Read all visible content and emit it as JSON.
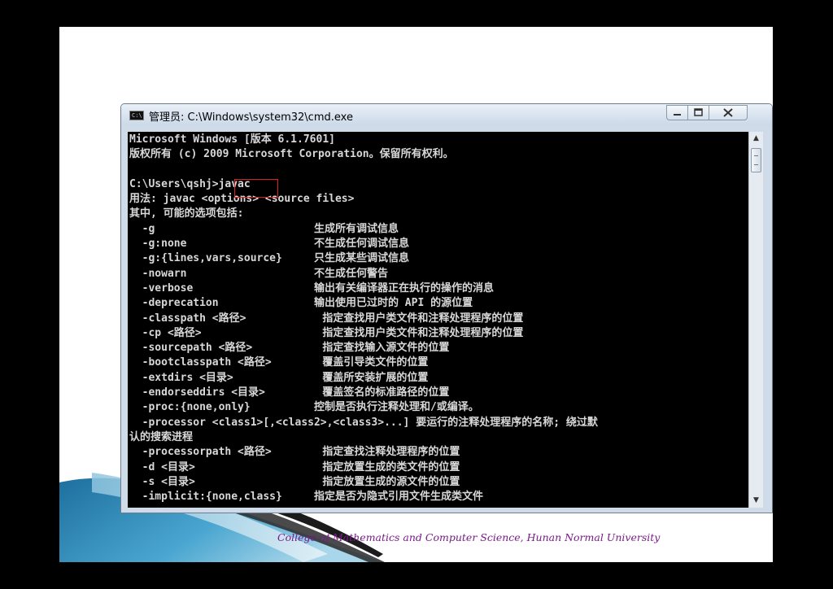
{
  "window": {
    "title": "管理员: C:\\Windows\\system32\\cmd.exe",
    "icon": "cmd-icon",
    "controls": {
      "minimize": "minimize-icon",
      "maximize": "maximize-icon",
      "close": "close-icon"
    }
  },
  "console": {
    "lines": [
      "Microsoft Windows [版本 6.1.7601]",
      "版权所有 (c) 2009 Microsoft Corporation。保留所有权利。",
      "",
      "C:\\Users\\qshj>javac",
      "用法: javac <options> <source files>",
      "其中, 可能的选项包括:",
      "  -g                         生成所有调试信息",
      "  -g:none                    不生成任何调试信息",
      "  -g:{lines,vars,source}     只生成某些调试信息",
      "  -nowarn                    不生成任何警告",
      "  -verbose                   输出有关编译器正在执行的操作的消息",
      "  -deprecation               输出使用已过时的 API 的源位置",
      "  -classpath <路径>            指定查找用户类文件和注释处理程序的位置",
      "  -cp <路径>                   指定查找用户类文件和注释处理程序的位置",
      "  -sourcepath <路径>           指定查找输入源文件的位置",
      "  -bootclasspath <路径>        覆盖引导类文件的位置",
      "  -extdirs <目录>              覆盖所安装扩展的位置",
      "  -endorseddirs <目录>         覆盖签名的标准路径的位置",
      "  -proc:{none,only}          控制是否执行注释处理和/或编译。",
      "  -processor <class1>[,<class2>,<class3>...] 要运行的注释处理程序的名称; 绕过默",
      "认的搜索进程",
      "  -processorpath <路径>        指定查找注释处理程序的位置",
      "  -d <目录>                    指定放置生成的类文件的位置",
      "  -s <目录>                    指定放置生成的源文件的位置",
      "  -implicit:{none,class}     指定是否为隐式引用文件生成类文件"
    ],
    "highlighted_text": "javac"
  },
  "scrollbar": {
    "up": "scroll-up-arrow",
    "down": "scroll-down-arrow"
  },
  "footer": {
    "text": "College of Mathematics and Computer Science,    Hunan Normal University"
  },
  "colors": {
    "console_bg": "#000000",
    "console_fg": "#d8d8d8",
    "highlight": "#e02020",
    "footer": "#7a1a8a",
    "accent": "#2a8fc0"
  }
}
